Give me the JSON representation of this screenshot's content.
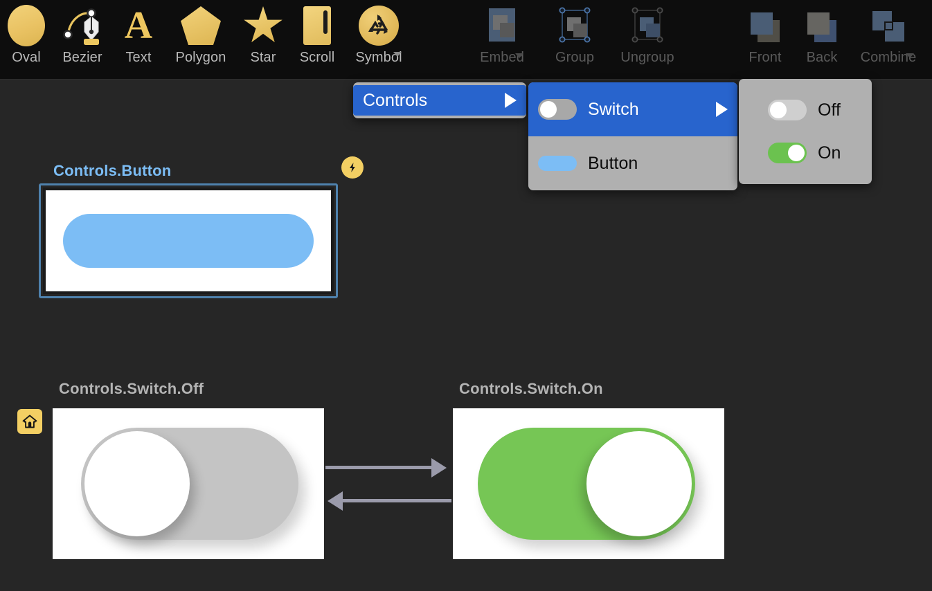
{
  "app": {
    "canvas_bg": "#262626",
    "toolbar_bg": "#0d0d0d",
    "accent_gold": "#eec75f",
    "accent_blue": "#7cbdf5",
    "menu_highlight": "#2864cd",
    "switch_on_green": "#6bc24f",
    "switch_off_gray": "#c4c4c4",
    "arrow_gray": "#9b9bab"
  },
  "toolbar": {
    "tools": [
      {
        "label": "Oval",
        "icon": "oval-icon",
        "enabled": true,
        "has_caret": false
      },
      {
        "label": "Bezier",
        "icon": "bezier-pen-icon",
        "enabled": true,
        "has_caret": false
      },
      {
        "label": "Text",
        "icon": "text-icon",
        "enabled": true,
        "has_caret": false
      },
      {
        "label": "Polygon",
        "icon": "polygon-icon",
        "enabled": true,
        "has_caret": false
      },
      {
        "label": "Star",
        "icon": "star-icon",
        "enabled": true,
        "has_caret": false
      },
      {
        "label": "Scroll",
        "icon": "scroll-icon",
        "enabled": true,
        "has_caret": false
      },
      {
        "label": "Symbol",
        "icon": "symbol-recycle-icon",
        "enabled": true,
        "has_caret": true
      },
      {
        "label": "Embed",
        "icon": "embed-icon",
        "enabled": false,
        "has_caret": true
      },
      {
        "label": "Group",
        "icon": "group-icon",
        "enabled": false,
        "has_caret": false
      },
      {
        "label": "Ungroup",
        "icon": "ungroup-icon",
        "enabled": false,
        "has_caret": false
      },
      {
        "label": "Front",
        "icon": "bring-front-icon",
        "enabled": false,
        "has_caret": false
      },
      {
        "label": "Back",
        "icon": "send-back-icon",
        "enabled": false,
        "has_caret": false
      },
      {
        "label": "Combine",
        "icon": "combine-icon",
        "enabled": false,
        "has_caret": true
      }
    ]
  },
  "menus": {
    "symbol_menu": {
      "items": [
        {
          "label": "Controls",
          "selected": true,
          "has_submenu": true
        }
      ]
    },
    "controls_submenu": {
      "items": [
        {
          "label": "Switch",
          "selected": true,
          "has_submenu": true,
          "preview": "switch-off-preview"
        },
        {
          "label": "Button",
          "selected": false,
          "has_submenu": false,
          "preview": "button-pill-preview"
        }
      ]
    },
    "switch_submenu": {
      "items": [
        {
          "label": "Off",
          "selected": false,
          "has_submenu": false,
          "preview": "switch-off-preview"
        },
        {
          "label": "On",
          "selected": false,
          "has_submenu": false,
          "preview": "switch-on-preview"
        }
      ]
    }
  },
  "canvas": {
    "artboards": [
      {
        "title": "Controls.Button",
        "selected": true,
        "badge": "lightning-bolt-badge",
        "content": "blue-rounded-button"
      },
      {
        "title": "Controls.Switch.Off",
        "selected": false,
        "badge": "home-badge",
        "content": "gray-switch-off"
      },
      {
        "title": "Controls.Switch.On",
        "selected": false,
        "badge": null,
        "content": "green-switch-on"
      }
    ],
    "connections": [
      {
        "from": "Controls.Switch.Off",
        "to": "Controls.Switch.On",
        "direction": "right"
      },
      {
        "from": "Controls.Switch.On",
        "to": "Controls.Switch.Off",
        "direction": "left"
      }
    ]
  }
}
